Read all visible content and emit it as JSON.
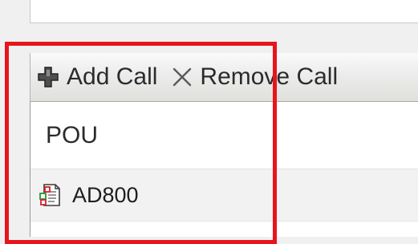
{
  "toolbar": {
    "add_label": "Add Call",
    "add_icon": "plus-icon",
    "remove_label": "Remove Call",
    "remove_icon": "cross-icon"
  },
  "table": {
    "column_header": "POU",
    "rows": [
      {
        "label": "AD800",
        "icon": "pou-document-icon"
      }
    ]
  },
  "highlight": {
    "color": "#e8141b"
  }
}
